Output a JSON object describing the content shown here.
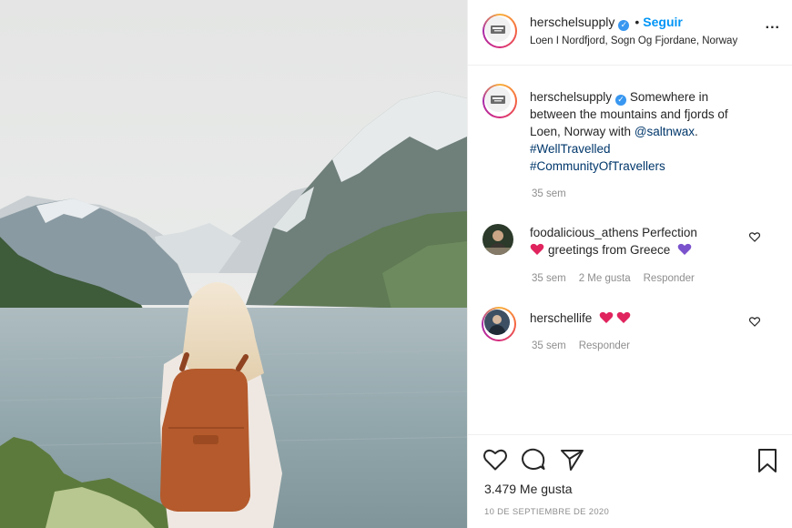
{
  "post": {
    "username": "herschelsupply",
    "follow_label": "Seguir",
    "separator": "•",
    "location": "Loen I Nordfjord, Sogn Og Fjordane, Norway",
    "more_label": "..."
  },
  "caption": {
    "username": "herschelsupply",
    "text_line1": "Somewhere in",
    "text_line2": "between the mountains and fjords of",
    "text_line3_prefix": "Loen, Norway with ",
    "mention": "@saltnwax",
    "text_line3_suffix": ".",
    "hashtag1": "#WellTravelled",
    "hashtag2": "#CommunityOfTravellers",
    "time": "35 sem"
  },
  "comments": [
    {
      "username": "foodalicious_athens",
      "text_line1": "Perfection",
      "text_line2": "greetings from Greece",
      "time": "35 sem",
      "likes": "2 Me gusta",
      "reply": "Responder"
    },
    {
      "username": "herschellife",
      "time": "35 sem",
      "reply": "Responder"
    }
  ],
  "icons": {
    "verified": "verified-badge-icon",
    "like": "heart-icon",
    "comment": "comment-bubble-icon",
    "share": "paper-plane-icon",
    "save": "bookmark-icon"
  },
  "footer": {
    "likes": "3.479 Me gusta",
    "date": "10 DE SEPTIEMBRE DE 2020"
  },
  "colors": {
    "accent": "#0095f6",
    "verified": "#3897f0",
    "heart_red": "#e0245e",
    "heart_purple": "#7a52cc",
    "muted_text": "#8e8e8e",
    "border": "#efefef"
  }
}
